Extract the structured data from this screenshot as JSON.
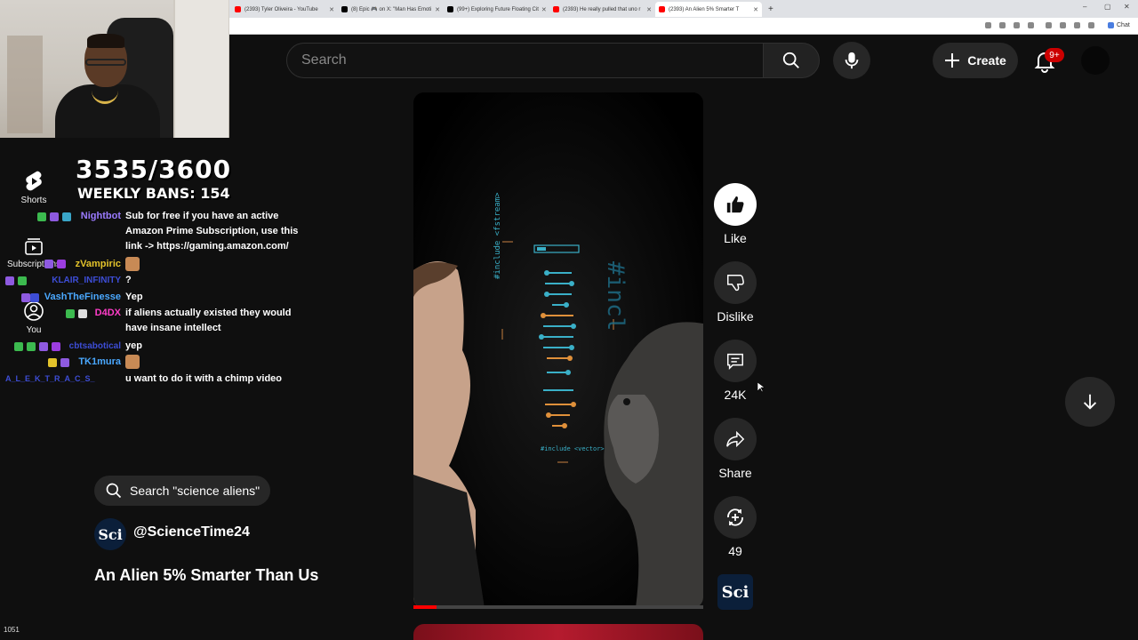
{
  "browser": {
    "tabs": [
      {
        "label": "(2393) Tyler Oliveira - YouTube",
        "color": "#ff0000"
      },
      {
        "label": "(8) Epic 🎮 on X: \"Man Has Emoti",
        "color": "#000000"
      },
      {
        "label": "(99+) Exploring Future Floating Cit",
        "color": "#000000"
      },
      {
        "label": "(2393) He really pulled that uno r",
        "color": "#ff0000"
      },
      {
        "label": "(2393) An Alien 5% Smarter T",
        "color": "#ff0000",
        "active": true
      }
    ],
    "new_tab": "+",
    "window_controls": [
      "–",
      "▢",
      "✕"
    ],
    "chat_ext": "Chat"
  },
  "search": {
    "placeholder": "Search"
  },
  "header": {
    "create_label": "Create",
    "notifications_badge": "9+"
  },
  "nav": [
    {
      "label": "Shorts",
      "icon": "shorts-icon"
    },
    {
      "label": "Subscriptions",
      "icon": "subscriptions-icon"
    },
    {
      "label": "You",
      "icon": "you-icon"
    }
  ],
  "overlay": {
    "sub_count": "3535/3600",
    "weekly_bans": "WEEKLY BANS: 154"
  },
  "chat": [
    {
      "user": "Nightbot",
      "color": "#9b7bff",
      "text": "Sub for free if you have an active Amazon Prime Subscription, use this link -> https://gaming.amazon.com/"
    },
    {
      "user": "zVampiric",
      "color": "#e3c32b",
      "text": "?"
    },
    {
      "user": "KLAIR_INFINITY",
      "color": "#3d4dd6",
      "text": ""
    },
    {
      "user": "VashTheFinesse",
      "color": "#4aa8ff",
      "text": "Yep"
    },
    {
      "user": "D4DX",
      "color": "#ff3dc8",
      "text": "if aliens actually existed they would have insane intellect"
    },
    {
      "user": "cbtsabotical",
      "color": "#3d4dd6",
      "text": "yep"
    },
    {
      "user": "TK1mura",
      "color": "#4aa8ff",
      "text": ""
    },
    {
      "user": "A_L_E_K_T_R_A_C_S_",
      "color": "#3d4dd6",
      "text": "u want to do it with a chimp video"
    }
  ],
  "channel": {
    "search_pill": "Search \"science aliens\"",
    "avatar_text": "Sci",
    "handle": "@ScienceTime24",
    "title": "An Alien 5% Smarter Than Us"
  },
  "actions": {
    "like": "Like",
    "dislike": "Dislike",
    "comments": "24K",
    "share": "Share",
    "remix": "49"
  },
  "video": {
    "progress": 0.08,
    "code_left": "#include <fstream>",
    "code_right": "#incl",
    "code_bottom": "#include <vector>"
  },
  "footer": {
    "viewer_count": "1051"
  }
}
